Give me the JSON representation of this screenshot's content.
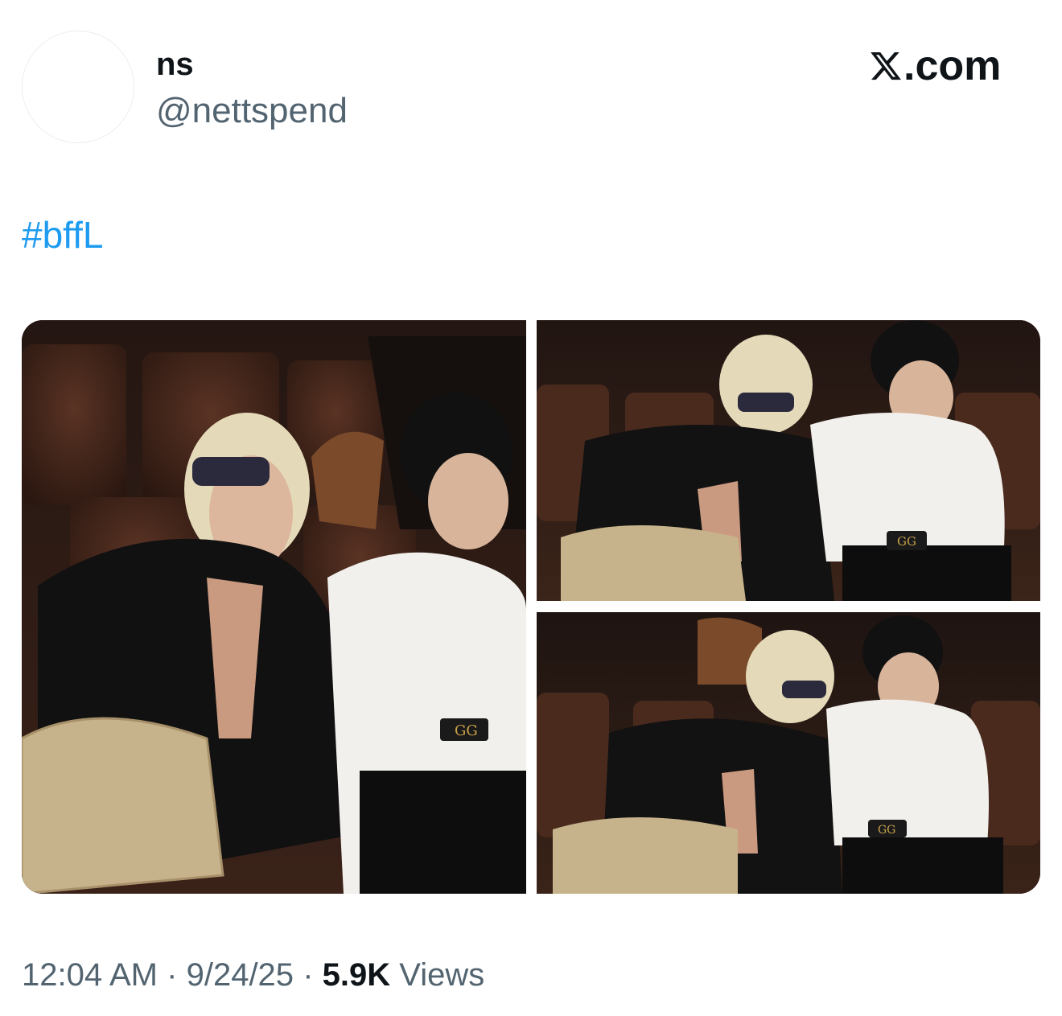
{
  "author": {
    "display_name": "ns",
    "handle": "@nettspend"
  },
  "brand": {
    "logo_icon": "x-logo-icon",
    "suffix": ".com"
  },
  "tweet": {
    "text": "#bffL"
  },
  "media": {
    "photo_count": 3,
    "photos": [
      {
        "alt": "photo-1"
      },
      {
        "alt": "photo-2"
      },
      {
        "alt": "photo-3"
      }
    ]
  },
  "meta": {
    "time": "12:04 AM",
    "separator": "·",
    "date": "9/24/25",
    "views_count": "5.9K",
    "views_label": "Views"
  },
  "colors": {
    "link": "#1d9bf0",
    "secondary_text": "#536471",
    "primary_text": "#0f1419"
  }
}
